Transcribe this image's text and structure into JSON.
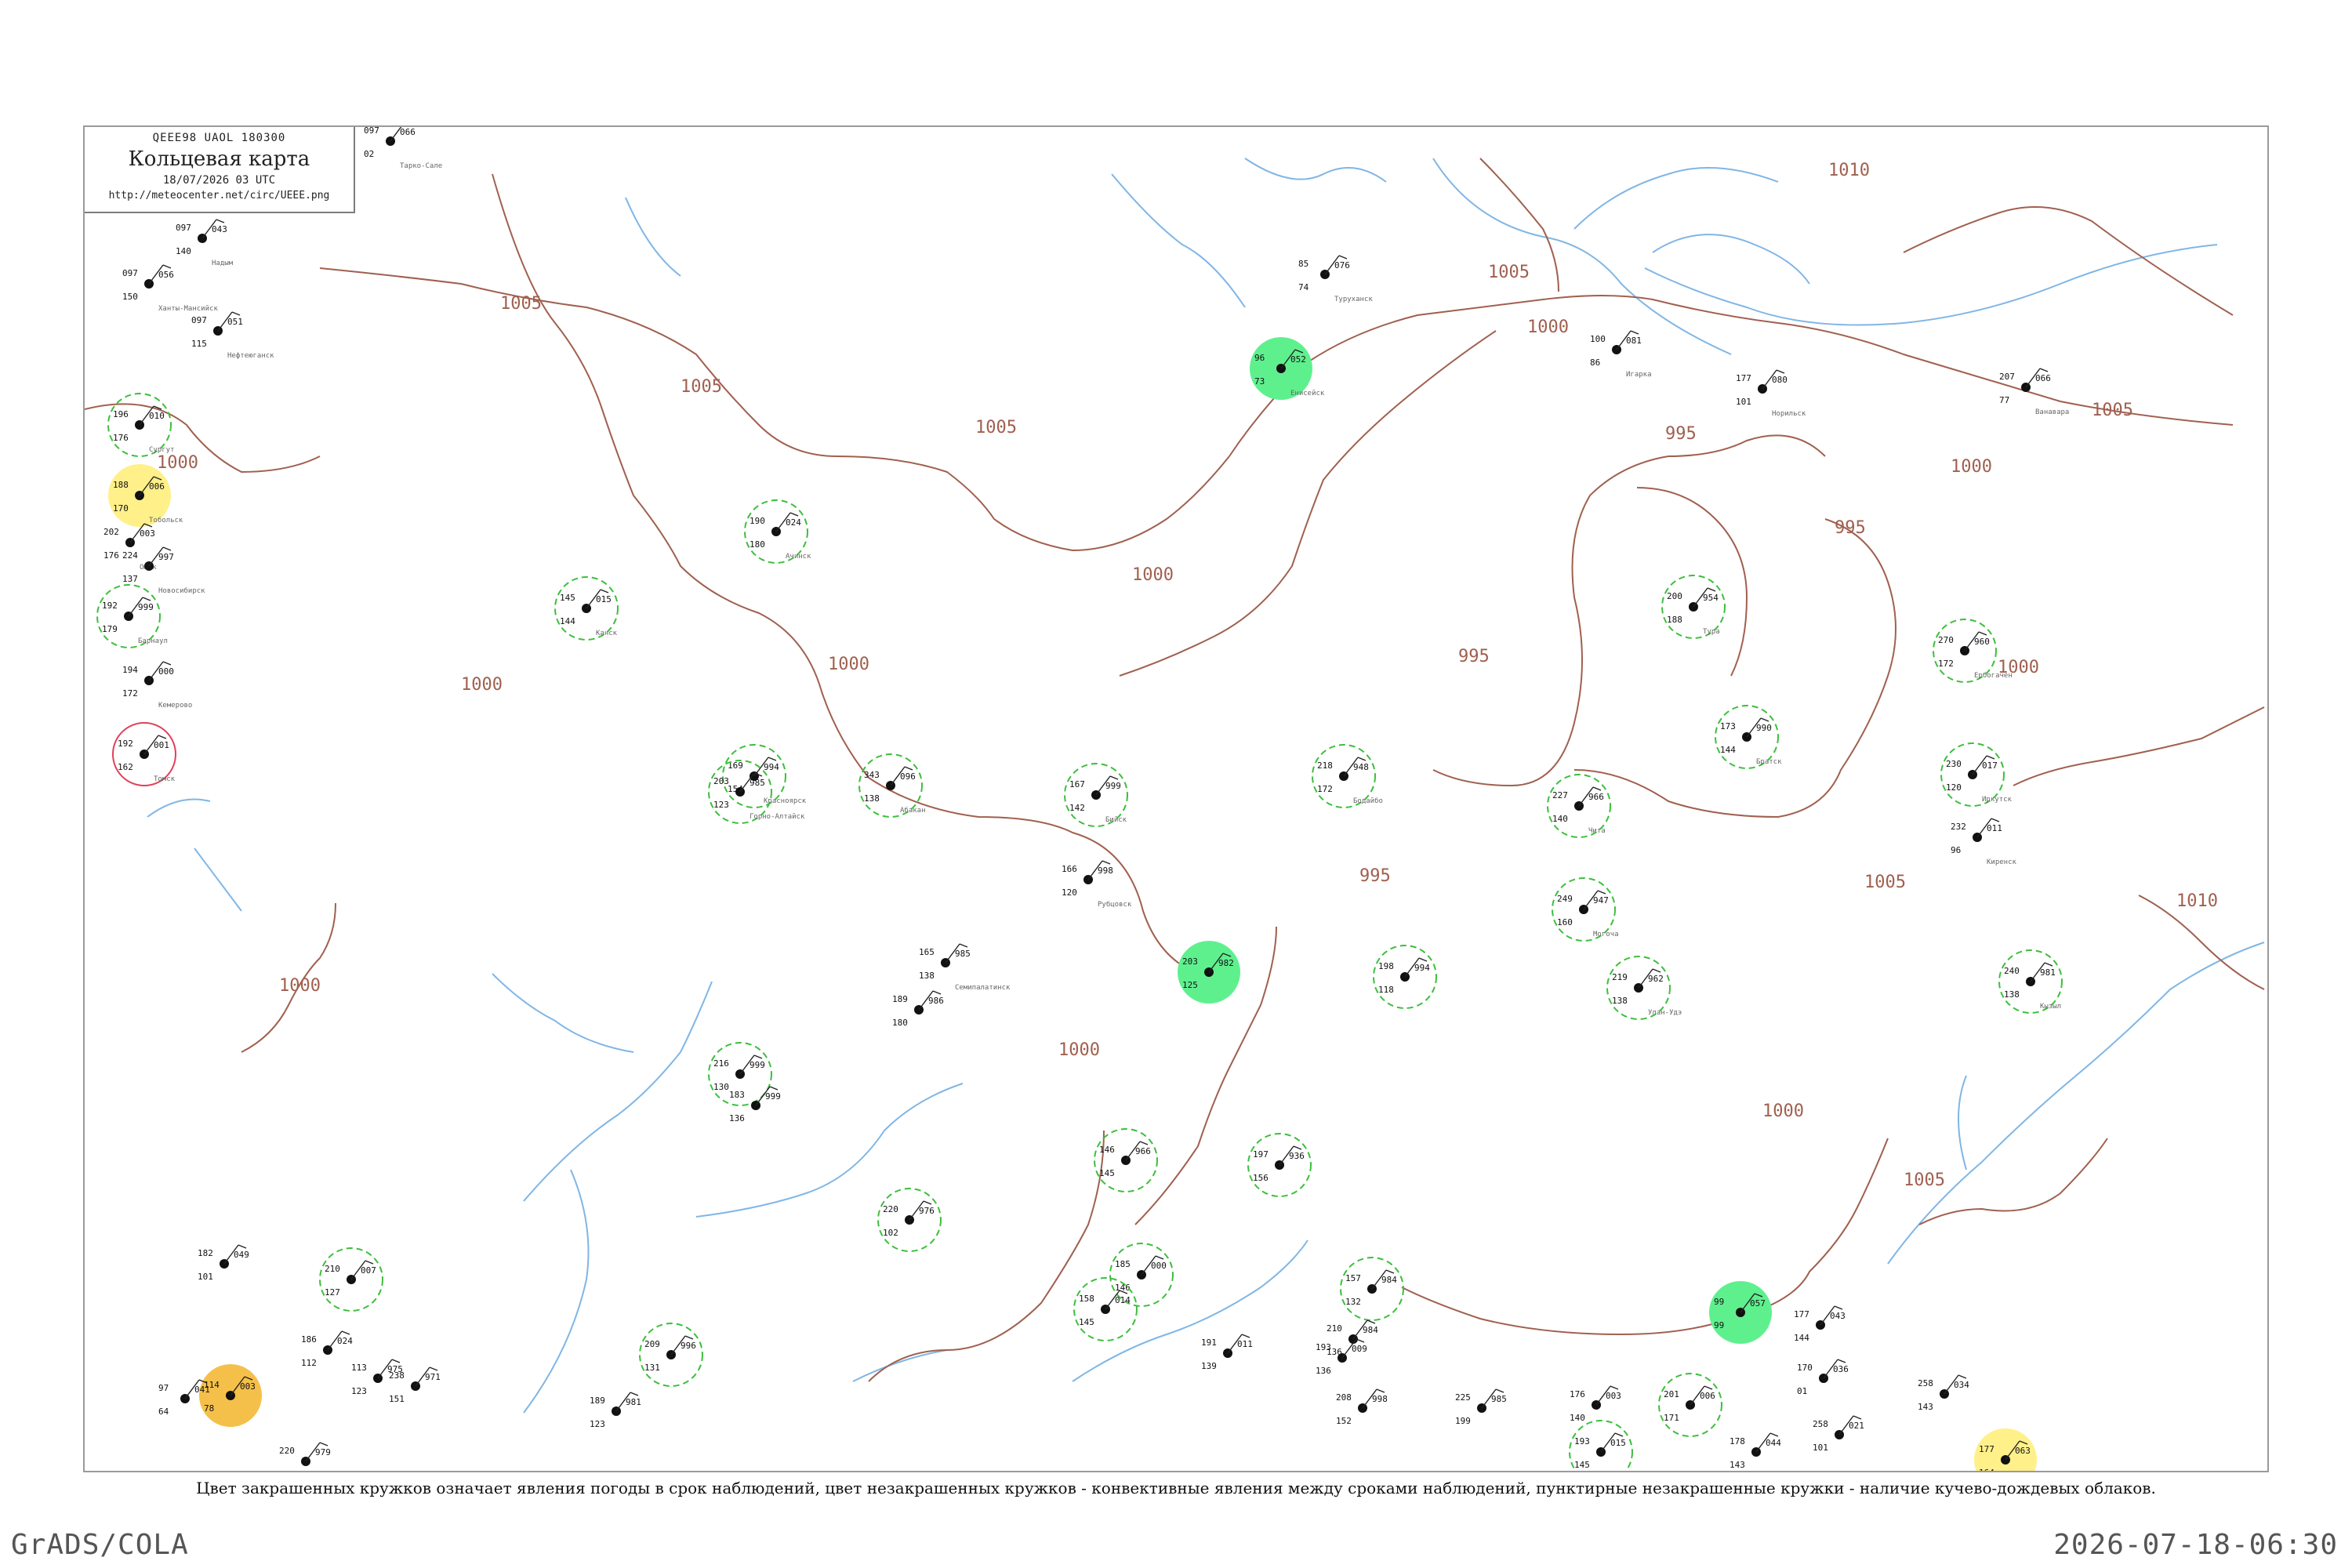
{
  "title_box": {
    "header": "QEEE98 UAOL 180300",
    "title": "Кольцевая карта",
    "datetime": "18/07/2026 03 UTC",
    "url": "http://meteocenter.net/circ/UEEE.png"
  },
  "caption": "Цвет закрашенных кружков означает явления погоды в срок наблюдений, цвет незакрашенных кружков - конвективные явления между сроками наблюдений, пунктирные незакрашенные кружки - наличие кучево-дождевых облаков.",
  "footer": {
    "left": "GrADS/COLA",
    "right": "2026-07-18-06:30"
  },
  "colors": {
    "isobar": "#a0604f",
    "river": "#7fb6e6",
    "shower": "#12b83a",
    "light_shower": "#5ff08e",
    "thunder": "#f0245a",
    "fog": "#fff08a",
    "haze": "#f5c04a",
    "dashed_cb": "#3cbf3c",
    "convective_ring": "#e0405a"
  },
  "isobars": [
    {
      "label": "1005"
    },
    {
      "label": "1000"
    },
    {
      "label": "995"
    },
    {
      "label": "1010"
    }
  ],
  "stations": [
    {
      "p": "066",
      "t": "097",
      "v": "02"
    },
    {
      "p": "043",
      "t": "097",
      "v": "140"
    },
    {
      "p": "056",
      "t": "097",
      "v": "150"
    },
    {
      "p": "051",
      "t": "097",
      "v": "115"
    },
    {
      "p": "010",
      "t": "196",
      "v": "176"
    },
    {
      "p": "006",
      "t": "188",
      "v": "170"
    },
    {
      "p": "003",
      "t": "202",
      "v": "176"
    },
    {
      "p": "997",
      "t": "224",
      "v": "137"
    },
    {
      "p": "999",
      "t": "192",
      "v": "179"
    },
    {
      "p": "000",
      "t": "194",
      "v": "172"
    },
    {
      "p": "001",
      "t": "192",
      "v": "162"
    },
    {
      "p": "994",
      "t": "169",
      "v": "154"
    },
    {
      "p": "024",
      "t": "190",
      "v": "180"
    },
    {
      "p": "015",
      "t": "145",
      "v": "144"
    },
    {
      "p": "052",
      "t": "96",
      "v": "73"
    },
    {
      "p": "076",
      "t": "85",
      "v": "74"
    },
    {
      "p": "081",
      "t": "100",
      "v": "86"
    },
    {
      "p": "080",
      "t": "177",
      "v": "101"
    },
    {
      "p": "066",
      "t": "207",
      "v": "77"
    },
    {
      "p": "954",
      "t": "200",
      "v": "188"
    },
    {
      "p": "960",
      "t": "270",
      "v": "172"
    },
    {
      "p": "990",
      "t": "173",
      "v": "144"
    },
    {
      "p": "017",
      "t": "230",
      "v": "120"
    },
    {
      "p": "011",
      "t": "232",
      "v": "96"
    },
    {
      "p": "948",
      "t": "218",
      "v": "172"
    },
    {
      "p": "966",
      "t": "227",
      "v": "140"
    },
    {
      "p": "947",
      "t": "249",
      "v": "160"
    },
    {
      "p": "962",
      "t": "219",
      "v": "138"
    },
    {
      "p": "981",
      "t": "240",
      "v": "138"
    },
    {
      "p": "096",
      "t": "343",
      "v": "138"
    },
    {
      "p": "985",
      "t": "203",
      "v": "123"
    },
    {
      "p": "999",
      "t": "167",
      "v": "142"
    },
    {
      "p": "998",
      "t": "166",
      "v": "120"
    },
    {
      "p": "985",
      "t": "165",
      "v": "138"
    },
    {
      "p": "986",
      "t": "189",
      "v": "180"
    },
    {
      "p": "999",
      "t": "216",
      "v": "130"
    },
    {
      "p": "999",
      "t": "183",
      "v": "136"
    },
    {
      "p": "982",
      "t": "203",
      "v": "125"
    },
    {
      "p": "994",
      "t": "198",
      "v": "118"
    },
    {
      "p": "966",
      "t": "146",
      "v": "145"
    },
    {
      "p": "936",
      "t": "197",
      "v": "156"
    },
    {
      "p": "976",
      "t": "220",
      "v": "102"
    },
    {
      "p": "000",
      "t": "185",
      "v": "146"
    },
    {
      "p": "984",
      "t": "157",
      "v": "132"
    },
    {
      "p": "984",
      "t": "210",
      "v": "136"
    },
    {
      "p": "014",
      "t": "158",
      "v": "145"
    },
    {
      "p": "011",
      "t": "191",
      "v": "139"
    },
    {
      "p": "009",
      "t": "193",
      "v": "136"
    },
    {
      "p": "998",
      "t": "208",
      "v": "152"
    },
    {
      "p": "985",
      "t": "225",
      "v": "199"
    },
    {
      "p": "057",
      "t": "99",
      "v": "99"
    },
    {
      "p": "043",
      "t": "177",
      "v": "144"
    },
    {
      "p": "036",
      "t": "170",
      "v": "01"
    },
    {
      "p": "034",
      "t": "258",
      "v": "143"
    },
    {
      "p": "063",
      "t": "177",
      "v": "164"
    },
    {
      "p": "044",
      "t": "178",
      "v": "143"
    },
    {
      "p": "006",
      "t": "201",
      "v": "171"
    },
    {
      "p": "003",
      "t": "176",
      "v": "140"
    },
    {
      "p": "021",
      "t": "258",
      "v": "101"
    },
    {
      "p": "015",
      "t": "193",
      "v": "145"
    },
    {
      "p": "971",
      "t": "238",
      "v": "151"
    },
    {
      "p": "981",
      "t": "189",
      "v": "123"
    },
    {
      "p": "996",
      "t": "209",
      "v": "131"
    },
    {
      "p": "003",
      "t": "114",
      "v": "78"
    },
    {
      "p": "041",
      "t": "97",
      "v": "64"
    },
    {
      "p": "979",
      "t": "220",
      "v": "85"
    },
    {
      "p": "049",
      "t": "182",
      "v": "101"
    },
    {
      "p": "975",
      "t": "113",
      "v": "123"
    },
    {
      "p": "024",
      "t": "186",
      "v": "112"
    },
    {
      "p": "007",
      "t": "210",
      "v": "127"
    }
  ],
  "station_names": [
    "Тарко-Сале",
    "Надым",
    "Ханты-Мансийск",
    "Нефтеюганск",
    "Сургут",
    "Тобольск",
    "Омск",
    "Новосибирск",
    "Барнаул",
    "Кемерово",
    "Томск",
    "Красноярск",
    "Ачинск",
    "Канск",
    "Енисейск",
    "Туруханск",
    "Игарка",
    "Норильск",
    "Ванавара",
    "Тура",
    "Ербогачен",
    "Братск",
    "Иркутск",
    "Киренск",
    "Бодайбо",
    "Чита",
    "Могоча",
    "Улан-Удэ",
    "Кызыл",
    "Абакан",
    "Горно-Алтайск",
    "Бийск",
    "Рубцовск",
    "Семипалатинск"
  ]
}
